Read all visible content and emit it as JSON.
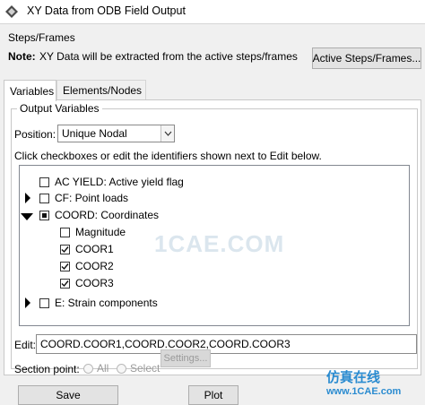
{
  "window": {
    "title": "XY Data from ODB Field Output",
    "icon": "abaqus-app-icon"
  },
  "steps_frames": {
    "heading": "Steps/Frames",
    "note_label": "Note:",
    "note_text": "XY Data will be extracted from the active steps/frames",
    "button_label": "Active Steps/Frames..."
  },
  "tabs": [
    {
      "label": "Variables",
      "active": true
    },
    {
      "label": "Elements/Nodes",
      "active": false
    }
  ],
  "output_variables": {
    "group_title": "Output Variables",
    "position_label": "Position:",
    "position_value": "Unique Nodal",
    "instructions": "Click checkboxes or edit the identifiers shown next to Edit below.",
    "tree": [
      {
        "label": "AC YIELD: Active yield flag",
        "checked": false,
        "expander": "none"
      },
      {
        "label": "CF: Point loads",
        "checked": false,
        "expander": "collapsed"
      },
      {
        "label": "COORD: Coordinates",
        "checked": "partial",
        "expander": "expanded"
      },
      {
        "label": "Magnitude",
        "checked": false,
        "expander": "none"
      },
      {
        "label": "COOR1",
        "checked": true,
        "expander": "none"
      },
      {
        "label": "COOR2",
        "checked": true,
        "expander": "none"
      },
      {
        "label": "COOR3",
        "checked": true,
        "expander": "none"
      },
      {
        "label": "E: Strain components",
        "checked": false,
        "expander": "collapsed"
      }
    ],
    "edit_label": "Edit:",
    "edit_value": "COORD.COOR1,COORD.COOR2,COORD.COOR3",
    "section_point_label": "Section point:",
    "radio_all": "All",
    "radio_select": "Select",
    "settings_button": "Settings..."
  },
  "buttons": {
    "save": "Save",
    "plot": "Plot"
  },
  "watermark": {
    "center_text": "1CAE.COM",
    "badge_cn": "仿真在线",
    "badge_url": "www.1CAE.com"
  },
  "colors": {
    "title_bar": "#ffffff",
    "dialog_bg": "#f0f0f0",
    "panel_bg": "#ffffff",
    "watermark": "#2a8bd0"
  }
}
